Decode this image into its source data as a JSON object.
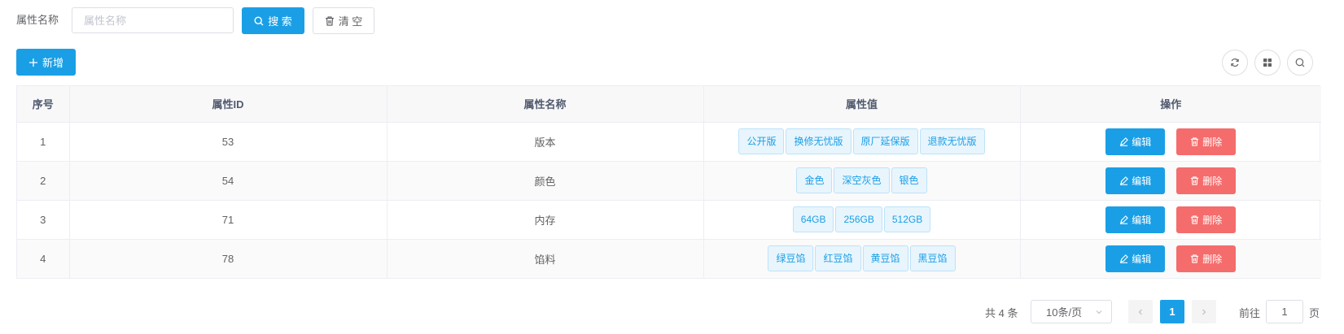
{
  "search": {
    "label": "属性名称",
    "placeholder": "属性名称",
    "value": "",
    "search_button": "搜 索",
    "clear_button": "清 空"
  },
  "toolbar": {
    "add_button": "新增",
    "tools": [
      {
        "name": "refresh-icon"
      },
      {
        "name": "columns-icon"
      },
      {
        "name": "search-icon"
      }
    ]
  },
  "table": {
    "headers": [
      "序号",
      "属性ID",
      "属性名称",
      "属性值",
      "操作"
    ],
    "rows": [
      {
        "index": "1",
        "id": "53",
        "name": "版本",
        "values": [
          "公开版",
          "换修无忧版",
          "原厂延保版",
          "退款无忧版"
        ]
      },
      {
        "index": "2",
        "id": "54",
        "name": "颜色",
        "values": [
          "金色",
          "深空灰色",
          "银色"
        ]
      },
      {
        "index": "3",
        "id": "71",
        "name": "内存",
        "values": [
          "64GB",
          "256GB",
          "512GB"
        ]
      },
      {
        "index": "4",
        "id": "78",
        "name": "馅料",
        "values": [
          "绿豆馅",
          "红豆馅",
          "黄豆馅",
          "黑豆馅"
        ]
      }
    ],
    "edit_label": "编辑",
    "delete_label": "删除"
  },
  "pagination": {
    "total_text": "共 4 条",
    "page_size": "10条/页",
    "current_page": "1",
    "goto_label": "前往",
    "goto_value": "1",
    "page_suffix": "页"
  },
  "colors": {
    "primary": "#1a9fe6",
    "danger": "#f56c6c",
    "tag_bg": "#e8f5fd"
  }
}
